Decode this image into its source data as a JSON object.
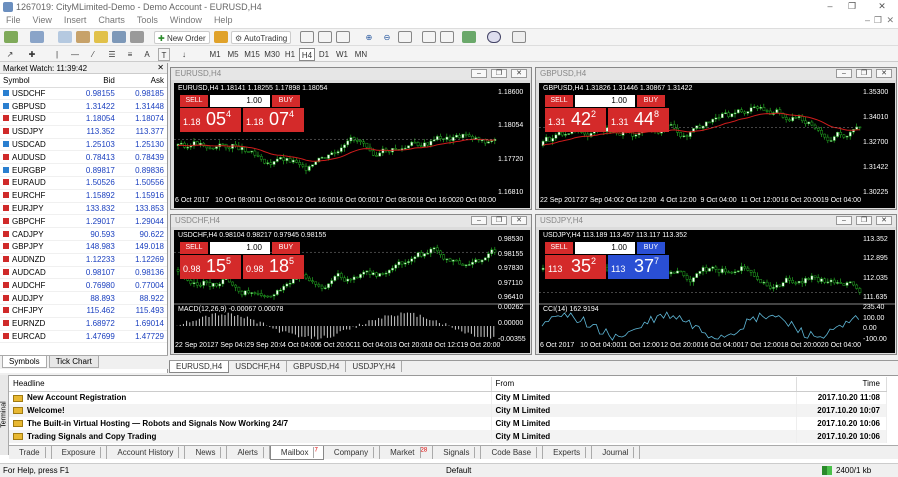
{
  "window": {
    "title": "1267019: CityMLimited-Demo - Demo Account - EURUSD,H4"
  },
  "menu": [
    "File",
    "View",
    "Insert",
    "Charts",
    "Tools",
    "Window",
    "Help"
  ],
  "toolbar": {
    "new_order": "New Order",
    "autotrading": "AutoTrading",
    "timeframes": [
      "M1",
      "M5",
      "M15",
      "M30",
      "H1",
      "H4",
      "D1",
      "W1",
      "MN"
    ]
  },
  "market_watch": {
    "title": "Market Watch: 11:39:42",
    "cols": [
      "Symbol",
      "Bid",
      "Ask"
    ],
    "rows": [
      {
        "symbol": "USDCHF",
        "bid": "0.98155",
        "ask": "0.98185",
        "dir": "up"
      },
      {
        "symbol": "GBPUSD",
        "bid": "1.31422",
        "ask": "1.31448",
        "dir": "up"
      },
      {
        "symbol": "EURUSD",
        "bid": "1.18054",
        "ask": "1.18074",
        "dir": "dn"
      },
      {
        "symbol": "USDJPY",
        "bid": "113.352",
        "ask": "113.377",
        "dir": "dn"
      },
      {
        "symbol": "USDCAD",
        "bid": "1.25103",
        "ask": "1.25130",
        "dir": "up"
      },
      {
        "symbol": "AUDUSD",
        "bid": "0.78413",
        "ask": "0.78439",
        "dir": "dn"
      },
      {
        "symbol": "EURGBP",
        "bid": "0.89817",
        "ask": "0.89836",
        "dir": "up"
      },
      {
        "symbol": "EURAUD",
        "bid": "1.50526",
        "ask": "1.50556",
        "dir": "dn"
      },
      {
        "symbol": "EURCHF",
        "bid": "1.15892",
        "ask": "1.15916",
        "dir": "dn"
      },
      {
        "symbol": "EURJPY",
        "bid": "133.832",
        "ask": "133.853",
        "dir": "dn"
      },
      {
        "symbol": "GBPCHF",
        "bid": "1.29017",
        "ask": "1.29044",
        "dir": "dn"
      },
      {
        "symbol": "CADJPY",
        "bid": "90.593",
        "ask": "90.622",
        "dir": "dn"
      },
      {
        "symbol": "GBPJPY",
        "bid": "148.983",
        "ask": "149.018",
        "dir": "dn"
      },
      {
        "symbol": "AUDNZD",
        "bid": "1.12233",
        "ask": "1.12269",
        "dir": "dn"
      },
      {
        "symbol": "AUDCAD",
        "bid": "0.98107",
        "ask": "0.98136",
        "dir": "dn"
      },
      {
        "symbol": "AUDCHF",
        "bid": "0.76980",
        "ask": "0.77004",
        "dir": "dn"
      },
      {
        "symbol": "AUDJPY",
        "bid": "88.893",
        "ask": "88.922",
        "dir": "dn"
      },
      {
        "symbol": "CHFJPY",
        "bid": "115.462",
        "ask": "115.493",
        "dir": "dn"
      },
      {
        "symbol": "EURNZD",
        "bid": "1.68972",
        "ask": "1.69014",
        "dir": "dn"
      },
      {
        "symbol": "EURCAD",
        "bid": "1.47699",
        "ask": "1.47729",
        "dir": "dn"
      }
    ],
    "tabs": [
      "Symbols",
      "Tick Chart"
    ]
  },
  "charts": [
    {
      "id": "eurusd",
      "title": "EURUSD,H4",
      "info": "EURUSD,H4  1.18141 1.18255 1.17898 1.18054",
      "lot": "1.00",
      "sell_small": "1.18",
      "sell_big": "05",
      "sell_sup": "4",
      "buy_small": "1.18",
      "buy_big": "07",
      "buy_sup": "4",
      "sell_label": "SELL",
      "buy_label": "BUY",
      "ylabels": [
        "1.18600",
        "1.18054",
        "1.17720",
        "1.16810"
      ],
      "xlabels": [
        "6 Oct 2017",
        "10 Oct 08:00",
        "11 Oct 08:00",
        "12 Oct 16:00",
        "16 Oct 00:00",
        "17 Oct 08:00",
        "18 Oct 16:00",
        "20 Oct 00:00"
      ]
    },
    {
      "id": "gbpusd",
      "title": "GBPUSD,H4",
      "info": "GBPUSD,H4  1.31826 1.31446 1.30867 1.31422",
      "lot": "1.00",
      "sell_small": "1.31",
      "sell_big": "42",
      "sell_sup": "2",
      "buy_small": "1.31",
      "buy_big": "44",
      "buy_sup": "8",
      "sell_label": "SELL",
      "buy_label": "BUY",
      "ylabels": [
        "1.35300",
        "1.34010",
        "1.32700",
        "1.31422",
        "1.30225"
      ],
      "xlabels": [
        "22 Sep 2017",
        "27 Sep 04:00",
        "2 Oct 12:00",
        "4 Oct 12:00",
        "9 Oct 04:00",
        "11 Oct 12:00",
        "16 Oct 20:00",
        "19 Oct 04:00"
      ]
    },
    {
      "id": "usdchf",
      "title": "USDCHF,H4",
      "info": "USDCHF,H4  0.98104 0.98217 0.97945 0.98155",
      "lot": "1.00",
      "sell_small": "0.98",
      "sell_big": "15",
      "sell_sup": "5",
      "buy_small": "0.98",
      "buy_big": "18",
      "buy_sup": "5",
      "sell_label": "SELL",
      "buy_label": "BUY",
      "ylabels": [
        "0.98530",
        "0.98155",
        "0.97830",
        "0.97110",
        "0.96410"
      ],
      "macd_labels": [
        "0.00262",
        "0.00000",
        "-0.00355"
      ],
      "indicator": "MACD(12,26,9) -0.00067 0.00078",
      "xlabels": [
        "22 Sep 2017",
        "27 Sep 04:00",
        "29 Sep 20:00",
        "4 Oct 04:00",
        "6 Oct 20:00",
        "11 Oct 04:00",
        "13 Oct 20:00",
        "18 Oct 12:00",
        "19 Oct 20:00"
      ]
    },
    {
      "id": "usdjpy",
      "title": "USDJPY,H4",
      "info": "USDJPY,H4  113.189 113.457 113.117 113.352",
      "lot": "1.00",
      "sell_small": "113",
      "sell_big": "35",
      "sell_sup": "2",
      "buy_small": "113",
      "buy_big": "37",
      "buy_sup": "7",
      "sell_label": "SELL",
      "buy_label": "BUY",
      "ylabels": [
        "113.352",
        "112.895",
        "112.035",
        "111.635"
      ],
      "cci_labels": [
        "235.40",
        "100.00",
        "0.00",
        "-100.00"
      ],
      "indicator": "CCI(14) 162.9194",
      "xlabels": [
        "6 Oct 2017",
        "10 Oct 04:00",
        "11 Oct 12:00",
        "12 Oct 20:00",
        "16 Oct 04:00",
        "17 Oct 12:00",
        "18 Oct 20:00",
        "20 Oct 04:00"
      ]
    }
  ],
  "chart_tabs": [
    "EURUSD,H4",
    "USDCHF,H4",
    "GBPUSD,H4",
    "USDJPY,H4"
  ],
  "terminal": {
    "cols": [
      "Headline",
      "From",
      "Time"
    ],
    "rows": [
      {
        "headline": "New Account Registration",
        "from": "City M Limited",
        "time": "2017.10.20 11:08"
      },
      {
        "headline": "Welcome!",
        "from": "City M Limited",
        "time": "2017.10.20 10:07"
      },
      {
        "headline": "The Built-in Virtual Hosting — Robots and Signals Now Working 24/7",
        "from": "City M Limited",
        "time": "2017.10.20 10:06"
      },
      {
        "headline": "Trading Signals and Copy Trading",
        "from": "City M Limited",
        "time": "2017.10.20 10:06"
      }
    ],
    "side_label": "Terminal",
    "tabs": [
      {
        "label": "Trade",
        "badge": ""
      },
      {
        "label": "Exposure",
        "badge": ""
      },
      {
        "label": "Account History",
        "badge": ""
      },
      {
        "label": "News",
        "badge": ""
      },
      {
        "label": "Alerts",
        "badge": ""
      },
      {
        "label": "Mailbox",
        "badge": "7"
      },
      {
        "label": "Company",
        "badge": ""
      },
      {
        "label": "Market",
        "badge": "28"
      },
      {
        "label": "Signals",
        "badge": ""
      },
      {
        "label": "Code Base",
        "badge": ""
      },
      {
        "label": "Experts",
        "badge": ""
      },
      {
        "label": "Journal",
        "badge": ""
      }
    ]
  },
  "status": {
    "help": "For Help, press F1",
    "profile": "Default",
    "traffic": "2400/1 kb"
  },
  "colors": {
    "sell": "#d42a2a",
    "buy_red": "#d42a2a",
    "buy_blue": "#2a4fd4",
    "candle_up": "#ffffff",
    "candle_dn": "#22aa22",
    "ma": "#d01c1c"
  }
}
